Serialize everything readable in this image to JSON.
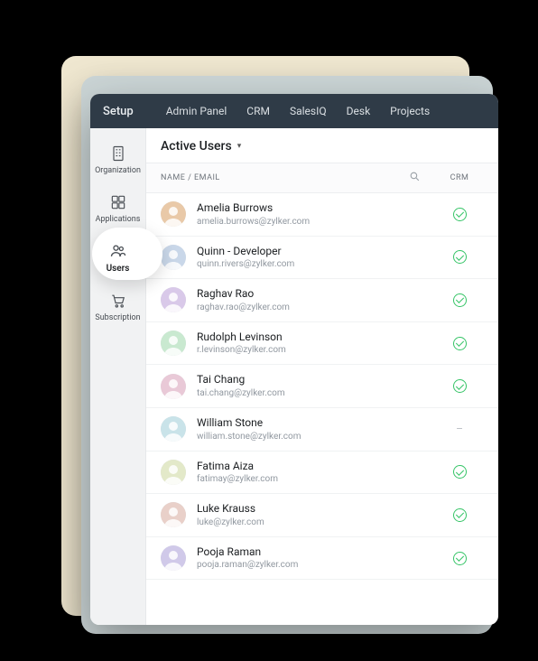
{
  "topbar": {
    "brand": "Setup",
    "nav": [
      "Admin Panel",
      "CRM",
      "SalesIQ",
      "Desk",
      "Projects"
    ]
  },
  "sidebar": {
    "items": [
      {
        "icon": "building-icon",
        "label": "Organization"
      },
      {
        "icon": "apps-icon",
        "label": "Applications"
      },
      {
        "icon": "users-icon",
        "label": "Users",
        "active": true
      },
      {
        "icon": "cart-icon",
        "label": "Subscription"
      }
    ]
  },
  "page": {
    "title": "Active Users"
  },
  "table": {
    "headers": {
      "name_email": "NAME / EMAIL",
      "crm": "CRM"
    },
    "rows": [
      {
        "name": "Amelia Burrows",
        "email": "amelia.burrows@zylker.com",
        "crm": "ok"
      },
      {
        "name": "Quinn - Developer",
        "email": "quinn.rivers@zylker.com",
        "crm": "ok"
      },
      {
        "name": "Raghav Rao",
        "email": "raghav.rao@zylker.com",
        "crm": "ok"
      },
      {
        "name": "Rudolph Levinson",
        "email": "r.levinson@zylker.com",
        "crm": "ok"
      },
      {
        "name": "Tai Chang",
        "email": "tai.chang@zylker.com",
        "crm": "ok"
      },
      {
        "name": "William Stone",
        "email": "william.stone@zylker.com",
        "crm": "none"
      },
      {
        "name": "Fatima Aiza",
        "email": "fatimay@zylker.com",
        "crm": "ok"
      },
      {
        "name": "Luke Krauss",
        "email": "luke@zylker.com",
        "crm": "ok"
      },
      {
        "name": "Pooja Raman",
        "email": "pooja.raman@zylker.com",
        "crm": "ok"
      }
    ]
  },
  "avatar_colors": [
    "#e9c9a8",
    "#c9d7e9",
    "#d9c9e9",
    "#c9e9d0",
    "#e9c9d7",
    "#c9e3e9",
    "#e3e9c9",
    "#e9d0c9",
    "#d0c9e9"
  ]
}
